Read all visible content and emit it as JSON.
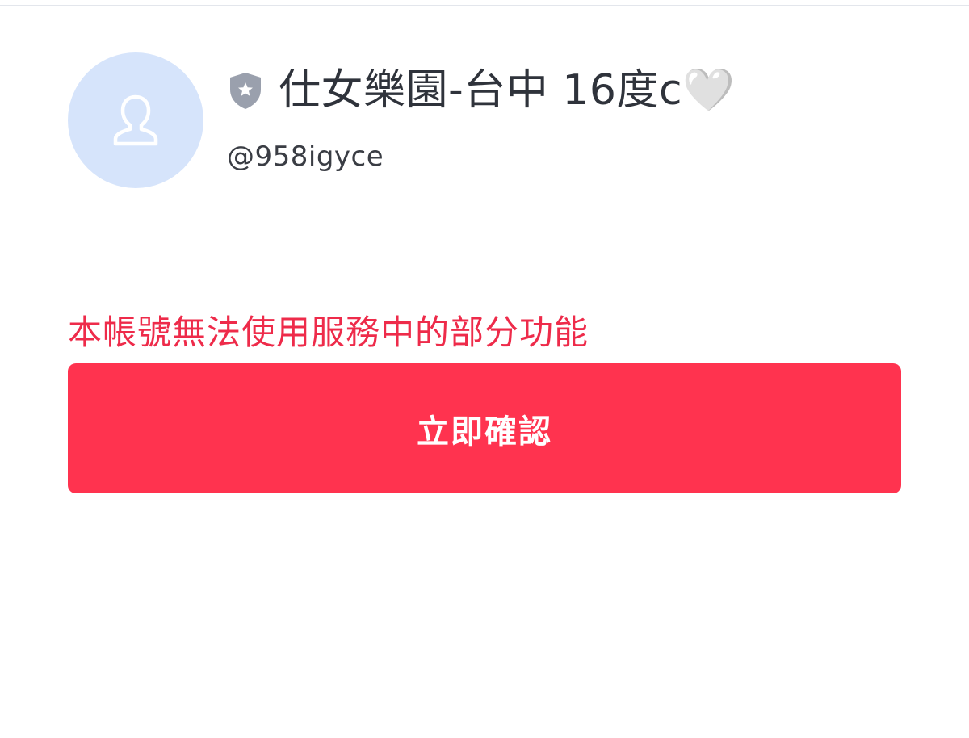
{
  "profile": {
    "display_name": "仕女樂園-台中 16度c🤍",
    "handle": "@958igyce",
    "avatar_icon": "person-placeholder-icon",
    "badge_icon": "shield-star-icon"
  },
  "notice": {
    "text": "本帳號無法使用服務中的部分功能",
    "color": "#ee2b4a"
  },
  "actions": {
    "confirm_label": "立即確認",
    "confirm_color": "#ff334f"
  },
  "colors": {
    "avatar_bg": "#d6e4fb",
    "badge": "#9aa0ad"
  }
}
